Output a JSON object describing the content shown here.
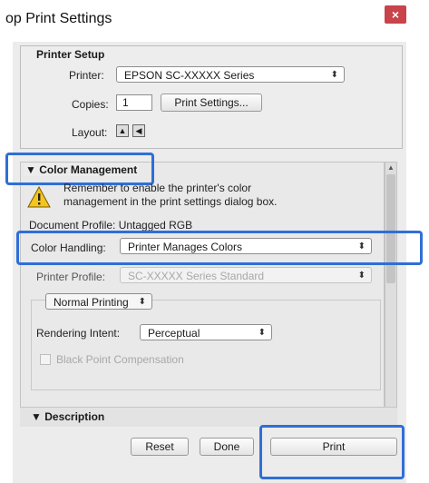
{
  "window": {
    "title": "op Print Settings",
    "close_label": "×"
  },
  "printer_setup": {
    "heading": "Printer Setup",
    "printer_label": "Printer:",
    "printer_value": "EPSON SC-XXXXX Series",
    "copies_label": "Copies:",
    "copies_value": "1",
    "print_settings_label": "Print Settings...",
    "layout_label": "Layout:"
  },
  "color_management": {
    "heading": "Color Management",
    "warning_line1": "Remember to enable the printer's color",
    "warning_line2": "management in the print settings dialog box.",
    "document_profile": "Document Profile: Untagged RGB",
    "color_handling_label": "Color Handling:",
    "color_handling_value": "Printer Manages Colors",
    "printer_profile_label": "Printer Profile:",
    "printer_profile_value": "SC-XXXXX Series Standard",
    "normal_printing": "Normal Printing",
    "rendering_intent_label": "Rendering Intent:",
    "rendering_intent_value": "Perceptual",
    "black_point_label": "Black Point Compensation"
  },
  "description": {
    "heading": "Description"
  },
  "footer": {
    "reset_label": "Reset",
    "done_label": "Done",
    "print_label": "Print"
  },
  "colors": {
    "highlight": "#2f6fd6",
    "close": "#c8434a"
  }
}
